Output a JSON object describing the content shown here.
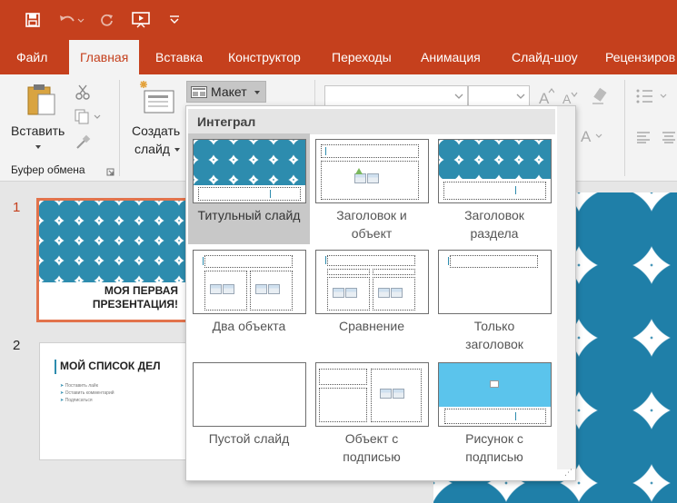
{
  "app": {
    "accent_color": "#c5401d"
  },
  "quick_access": [
    {
      "name": "save-icon"
    },
    {
      "name": "undo-icon"
    },
    {
      "name": "redo-icon"
    },
    {
      "name": "slideshow-from-start-icon"
    },
    {
      "name": "customize-qat-icon"
    }
  ],
  "tabs": [
    {
      "label": "Файл",
      "active": false
    },
    {
      "label": "Главная",
      "active": true
    },
    {
      "label": "Вставка",
      "active": false
    },
    {
      "label": "Конструктор",
      "active": false
    },
    {
      "label": "Переходы",
      "active": false
    },
    {
      "label": "Анимация",
      "active": false
    },
    {
      "label": "Слайд-шоу",
      "active": false
    },
    {
      "label": "Рецензиров",
      "active": false
    }
  ],
  "ribbon": {
    "paste_label": "Вставить",
    "clipboard_group": "Буфер обмена",
    "new_slide_line1": "Создать",
    "new_slide_line2": "слайд",
    "layout_label": "Макет"
  },
  "layout_menu": {
    "theme_name": "Интеграл",
    "layouts": [
      {
        "label": "Титульный слайд",
        "selected": true
      },
      {
        "label": "Заголовок и\nобъект",
        "selected": false
      },
      {
        "label": "Заголовок\nраздела",
        "selected": false
      },
      {
        "label": "Два объекта",
        "selected": false
      },
      {
        "label": "Сравнение",
        "selected": false
      },
      {
        "label": "Только\nзаголовок",
        "selected": false
      },
      {
        "label": "Пустой слайд",
        "selected": false
      },
      {
        "label": "Объект с\nподписью",
        "selected": false
      },
      {
        "label": "Рисунок с\nподписью",
        "selected": false
      }
    ]
  },
  "slides": [
    {
      "number": "1",
      "title_line1": "МОЯ ПЕРВАЯ",
      "title_line2": "ПРЕЗЕНТАЦИЯ!"
    },
    {
      "number": "2",
      "title": "МОЙ СПИСОК ДЕЛ",
      "bullets": [
        "Поставить лайк",
        "Оставить комментарий",
        "Подписаться"
      ]
    }
  ],
  "colors": {
    "theme_teal": "#2d8cae",
    "picture_blue": "#5bc4ec"
  }
}
